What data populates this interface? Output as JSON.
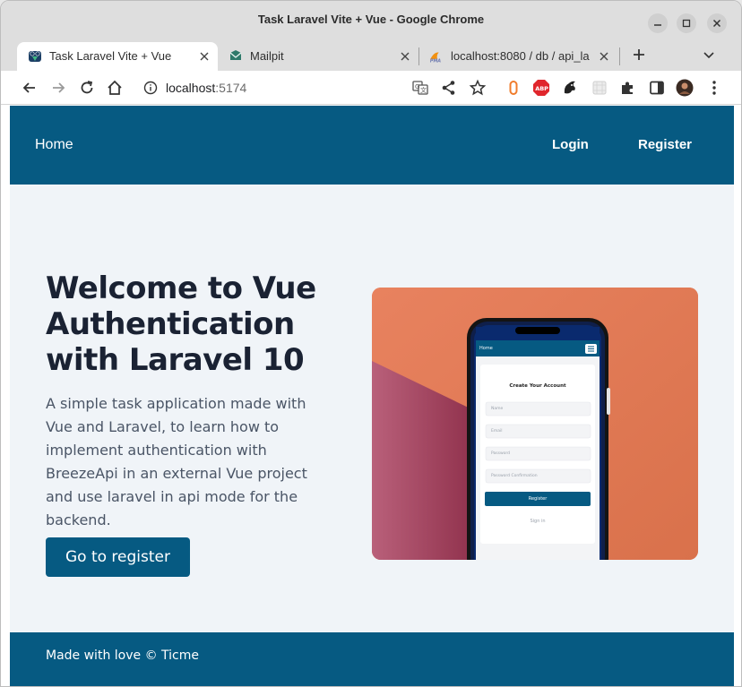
{
  "window": {
    "title": "Task Laravel Vite + Vue - Google Chrome"
  },
  "tabs": [
    {
      "label": "Task Laravel Vite + Vue",
      "active": true,
      "icon": "vue-laravel-favicon-icon"
    },
    {
      "label": "Mailpit",
      "active": false,
      "icon": "mailpit-favicon-icon"
    },
    {
      "label": "localhost:8080 / db / api_la",
      "active": false,
      "icon": "phpmyadmin-favicon-icon"
    }
  ],
  "toolbar": {
    "url_host": "localhost",
    "url_port": ":5174"
  },
  "page": {
    "navbar": {
      "home": "Home",
      "login": "Login",
      "register": "Register"
    },
    "hero": {
      "title": "Welcome to Vue Authentication with Laravel 10",
      "description": "A simple task application made with Vue and Laravel, to learn how to implement authentication with BreezeApi in an external Vue project and use laravel in api mode for the backend.",
      "button": "Go to register"
    },
    "phone_mockup": {
      "nav_home": "Home",
      "form_title": "Create Your Account",
      "fields": [
        "Name",
        "Email",
        "Password",
        "Password Confirmation"
      ],
      "submit": "Register",
      "signin": "Sign in"
    },
    "footer": {
      "text": "Made with love © Ticme"
    }
  },
  "colors": {
    "brand": "#065a82",
    "page_bg": "#f0f4f8",
    "image_bg": "#e07a57"
  }
}
